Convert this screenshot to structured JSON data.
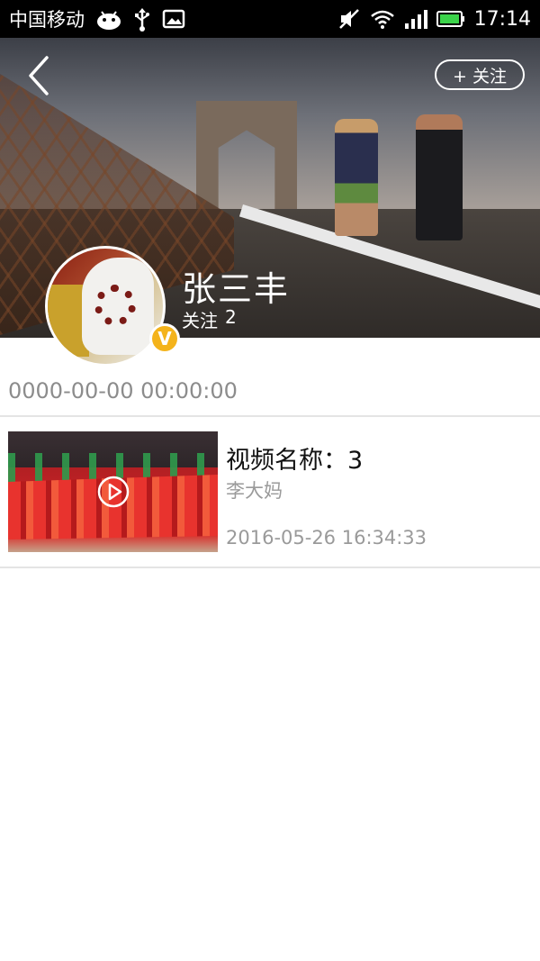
{
  "status_bar": {
    "carrier": "中国移动",
    "time": "17:14",
    "icons": [
      "android-icon",
      "usb-icon",
      "image-icon",
      "mute-icon",
      "wifi-icon",
      "signal-icon",
      "battery-icon"
    ]
  },
  "header": {
    "follow_button_label": "+ 关注"
  },
  "profile": {
    "name": "张三丰",
    "follow_label": "关注",
    "follow_count": "2",
    "badge": "V",
    "join_date": "0000-00-00 00:00:00"
  },
  "videos": [
    {
      "title": "视频名称：3",
      "author": "李大妈",
      "time": "2016-05-26 16:34:33"
    }
  ],
  "colors": {
    "badge": "#f4b31b",
    "secondary_text": "#9a9a9a",
    "divider": "#e4e4e4"
  }
}
